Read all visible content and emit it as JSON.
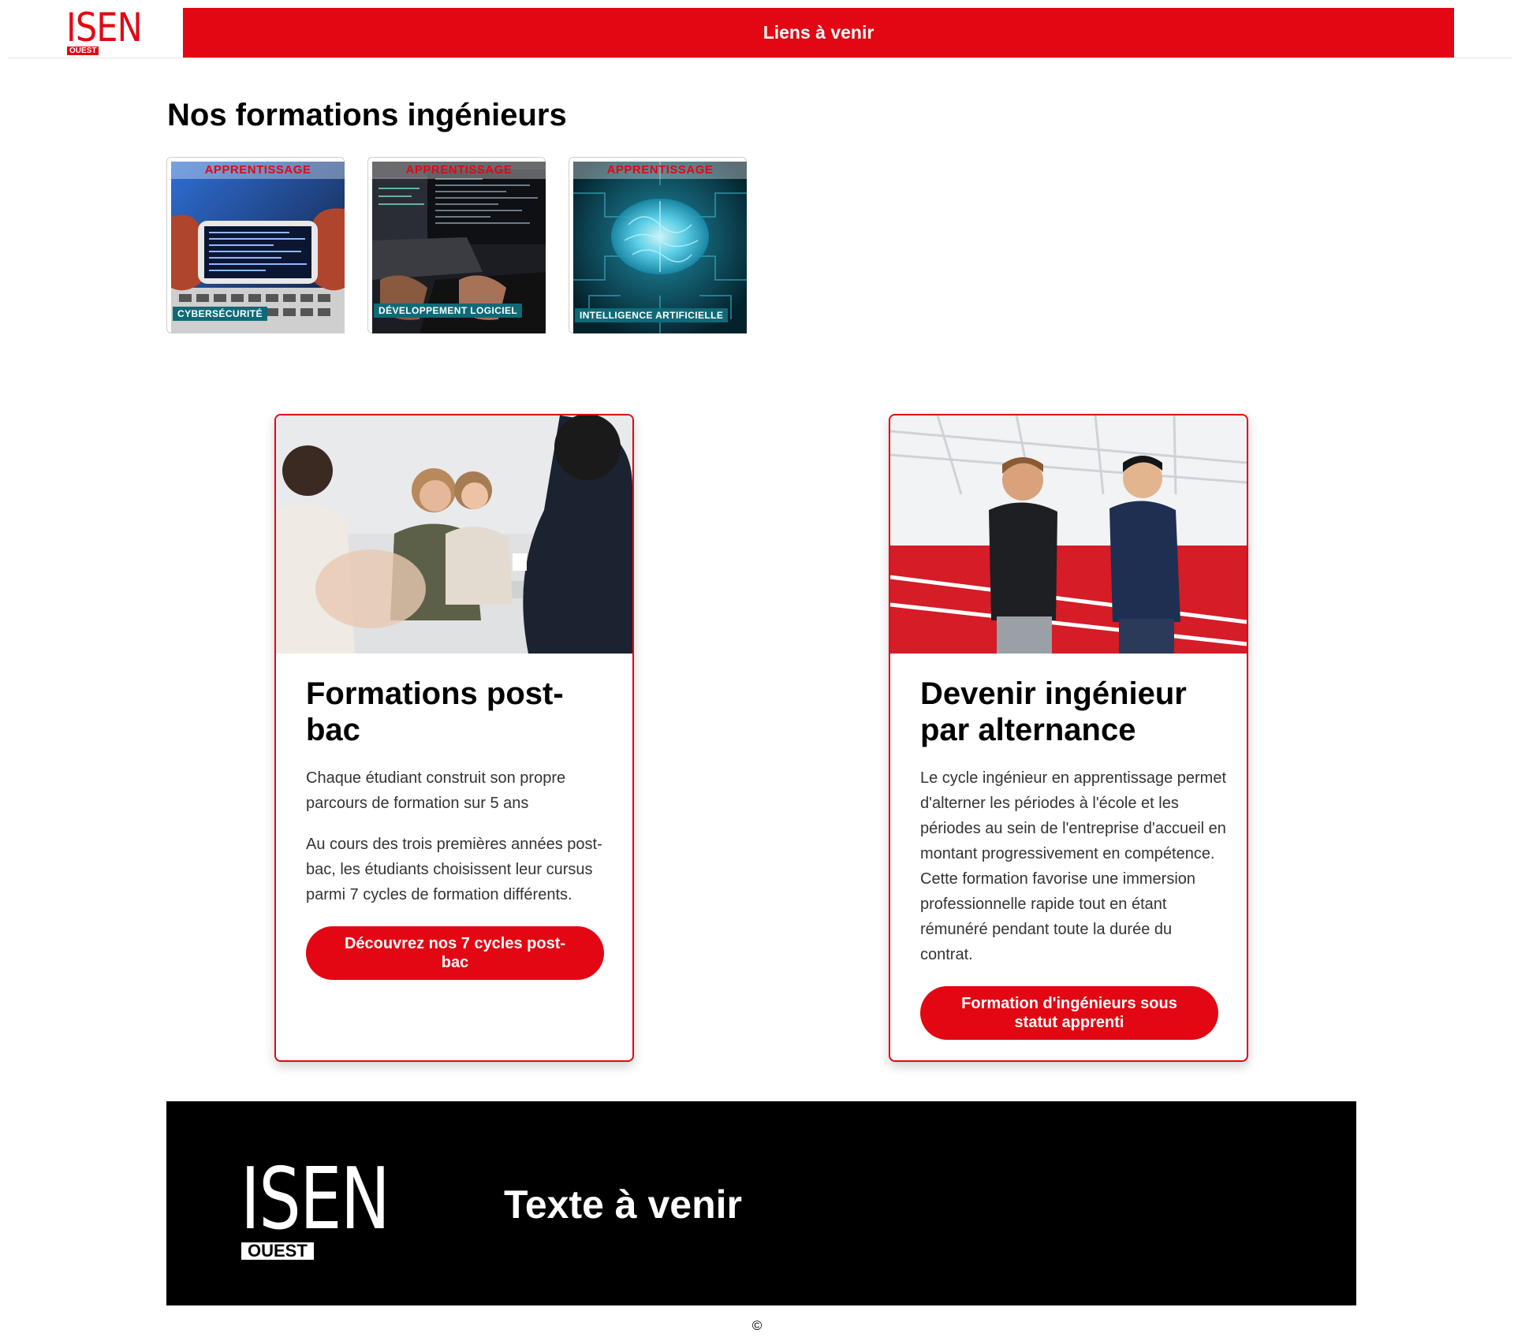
{
  "header": {
    "logo_word": "ISEN",
    "logo_tag": "OUEST",
    "nav_placeholder": "Liens à venir"
  },
  "formations": {
    "title": "Nos formations ingénieurs",
    "tiles": [
      {
        "badge": "APPRENTISSAGE",
        "label": "CYBERSÉCURITÉ"
      },
      {
        "badge": "APPRENTISSAGE",
        "label": "DÉVELOPPEMENT LOGICIEL"
      },
      {
        "badge": "APPRENTISSAGE",
        "label": "INTELLIGENCE ARTIFICIELLE"
      }
    ]
  },
  "cards": [
    {
      "title": "Formations post-bac",
      "paragraphs": [
        "Chaque étudiant construit son propre parcours de formation sur 5 ans",
        "Au cours des trois premières années post-bac, les étudiants choisissent leur cursus parmi 7 cycles de formation différents."
      ],
      "button": "Découvrez nos 7 cycles post-bac"
    },
    {
      "title": "Devenir ingénieur par alternance",
      "paragraphs": [
        "Le cycle ingénieur en apprentissage permet d'alterner les périodes à l'école et les périodes au sein de l'entreprise d'accueil en montant progressivement en compétence. Cette formation favorise une immersion professionnelle rapide tout en étant rémunéré pendant toute la durée du contrat."
      ],
      "button": "Formation d'ingénieurs sous statut apprenti"
    }
  ],
  "footer": {
    "logo_word": "ISEN",
    "logo_tag": "OUEST",
    "text": "Texte à venir"
  },
  "copyright": "©",
  "colors": {
    "brand_red": "#e30613",
    "tile_label_teal": "#0f6a77",
    "footer_bg": "#000000"
  }
}
